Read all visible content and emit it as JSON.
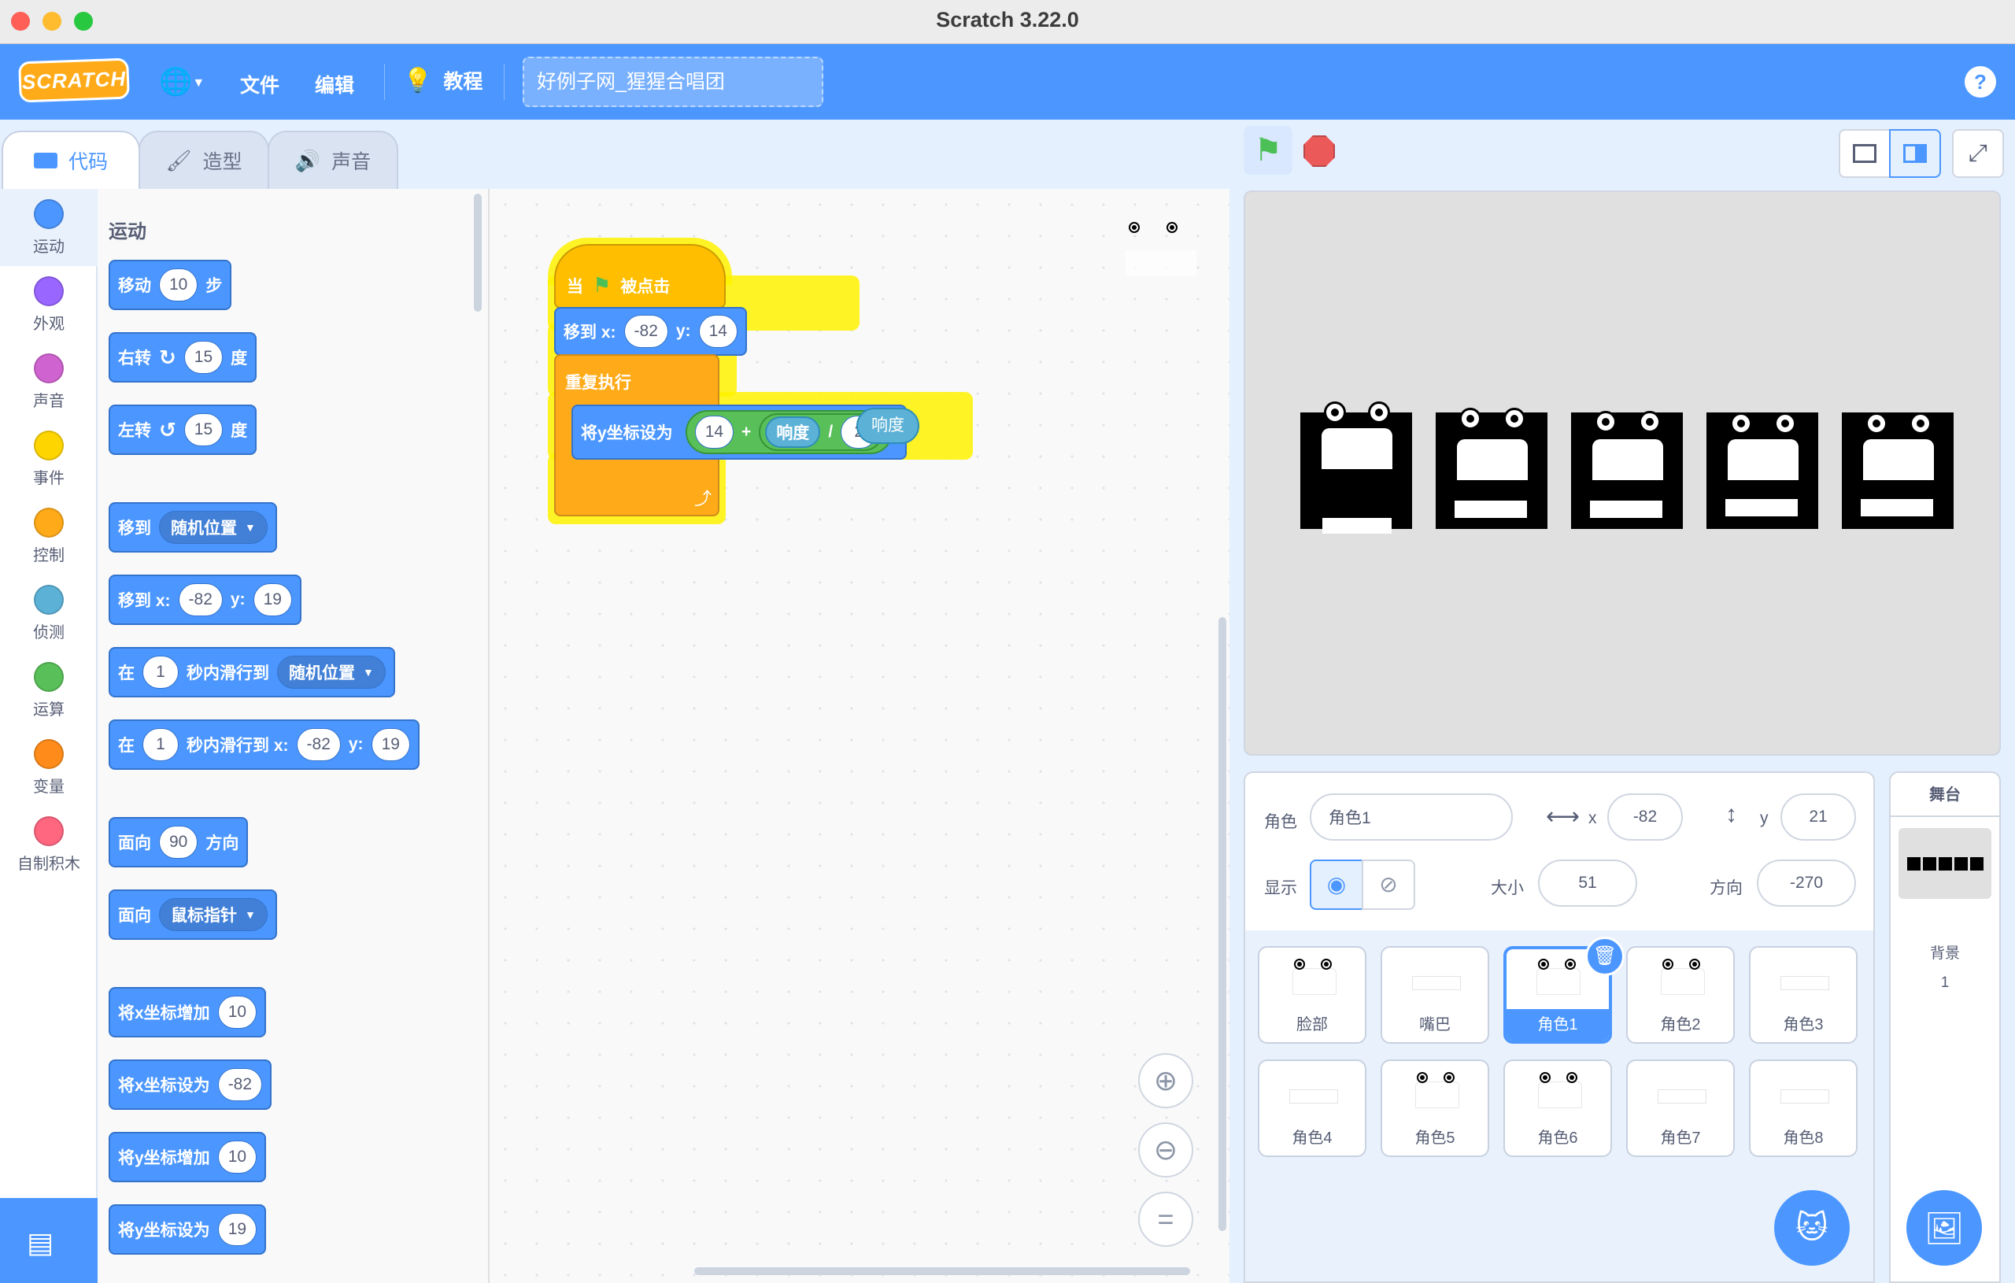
{
  "window": {
    "title": "Scratch 3.22.0"
  },
  "menubar": {
    "logo": "SCRATCH",
    "file": "文件",
    "edit": "编辑",
    "tutorials": "教程",
    "project_title": "好例子网_猩猩合唱团",
    "help": "?"
  },
  "tabs": {
    "code": "代码",
    "costumes": "造型",
    "sounds": "声音"
  },
  "categories": [
    {
      "label": "运动",
      "color": "#4c97ff"
    },
    {
      "label": "外观",
      "color": "#9966ff"
    },
    {
      "label": "声音",
      "color": "#cf63cf"
    },
    {
      "label": "事件",
      "color": "#ffd500"
    },
    {
      "label": "控制",
      "color": "#ffab19"
    },
    {
      "label": "侦测",
      "color": "#5cb1d6"
    },
    {
      "label": "运算",
      "color": "#59c059"
    },
    {
      "label": "变量",
      "color": "#ff8c1a"
    },
    {
      "label": "自制积木",
      "color": "#ff6680"
    }
  ],
  "palette": {
    "section": "运动",
    "move": {
      "a": "移动",
      "v": "10",
      "b": "步"
    },
    "turn_right": {
      "a": "右转",
      "v": "15",
      "b": "度"
    },
    "turn_left": {
      "a": "左转",
      "v": "15",
      "b": "度"
    },
    "goto": {
      "a": "移到",
      "v": "随机位置"
    },
    "goto_xy": {
      "a": "移到 x:",
      "x": "-82",
      "b": "y:",
      "y": "19"
    },
    "glide": {
      "a": "在",
      "v": "1",
      "b": "秒内滑行到",
      "t": "随机位置"
    },
    "glide_xy": {
      "a": "在",
      "v": "1",
      "b": "秒内滑行到 x:",
      "x": "-82",
      "c": "y:",
      "y": "19"
    },
    "point_dir": {
      "a": "面向",
      "v": "90",
      "b": "方向"
    },
    "point_towards": {
      "a": "面向",
      "v": "鼠标指针"
    },
    "change_x": {
      "a": "将x坐标增加",
      "v": "10"
    },
    "set_x": {
      "a": "将x坐标设为",
      "v": "-82"
    },
    "change_y": {
      "a": "将y坐标增加",
      "v": "10"
    },
    "set_y": {
      "a": "将y坐标设为",
      "v": "19"
    }
  },
  "script": {
    "hat_a": "当",
    "hat_b": "被点击",
    "goto_a": "移到 x:",
    "goto_x": "-82",
    "goto_b": "y:",
    "goto_y": "14",
    "forever": "重复执行",
    "sety": "将y坐标设为",
    "sety_n": "14",
    "plus": "+",
    "loud": "响度",
    "div": "/",
    "den": "2",
    "tooltip": "响度"
  },
  "stage_controls": {
    "flag": "green-flag",
    "stop": "stop"
  },
  "sprite_info": {
    "sprite_label": "角色",
    "sprite_name": "角色1",
    "x_label": "x",
    "x": "-82",
    "y_label": "y",
    "y": "21",
    "show_label": "显示",
    "size_label": "大小",
    "size": "51",
    "dir_label": "方向",
    "dir": "-270"
  },
  "sprites": [
    {
      "name": "脸部",
      "kind": "face"
    },
    {
      "name": "嘴巴",
      "kind": "mouth"
    },
    {
      "name": "角色1",
      "kind": "face"
    },
    {
      "name": "角色2",
      "kind": "face"
    },
    {
      "name": "角色3",
      "kind": "mouth"
    },
    {
      "name": "角色4",
      "kind": "mouth"
    },
    {
      "name": "角色5",
      "kind": "face"
    },
    {
      "name": "角色6",
      "kind": "face"
    },
    {
      "name": "角色7",
      "kind": "mouth"
    },
    {
      "name": "角色8",
      "kind": "mouth"
    }
  ],
  "selected_sprite": "角色1",
  "stage_panel": {
    "title": "舞台",
    "backdrops_label": "背景",
    "backdrops_count": "1"
  }
}
